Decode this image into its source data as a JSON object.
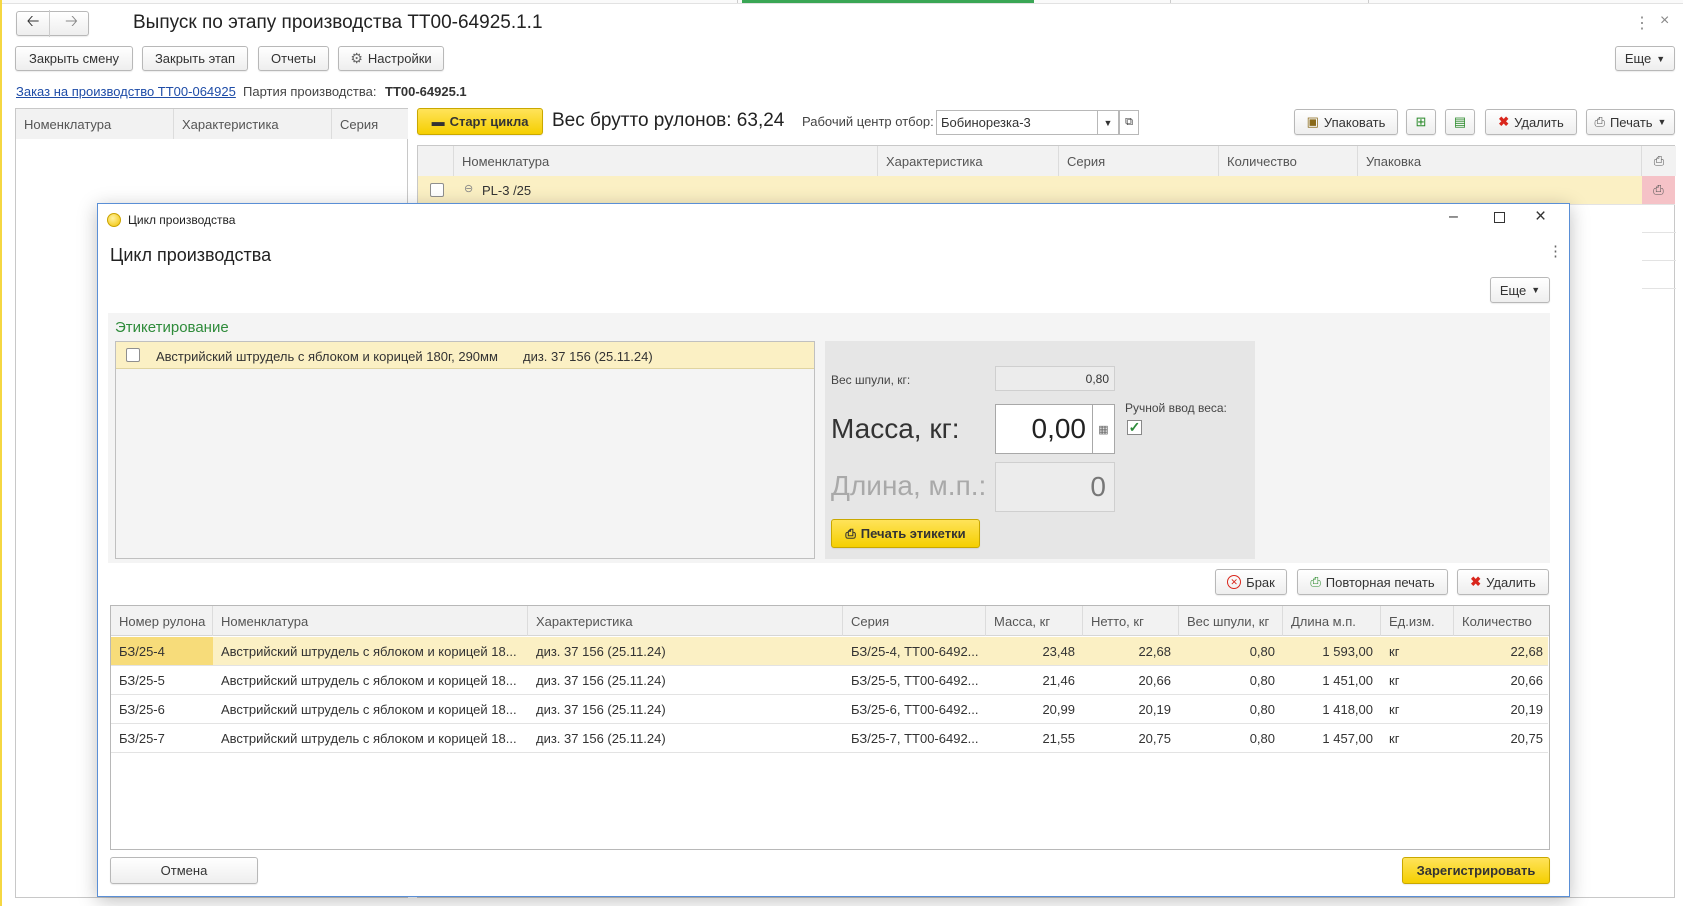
{
  "window": {
    "title": "Выпуск по этапу производства ТТ00-64925.1.1",
    "more_label": "Еще"
  },
  "toolbar": {
    "close_shift": "Закрыть смену",
    "close_stage": "Закрыть этап",
    "reports": "Отчеты",
    "settings": "Настройки"
  },
  "info": {
    "order_link": "Заказ на производство ТТ00-064925",
    "batch_label": "Партия производства:",
    "batch_value": "ТТ00-64925.1"
  },
  "left_table": {
    "columns": [
      "Номенклатура",
      "Характеристика",
      "Серия"
    ]
  },
  "cycle_bar": {
    "start_label": "Старт цикла",
    "gross_weight": "Вес брутто рулонов: 63,24",
    "workcenter_label": "Рабочий центр отбор:",
    "workcenter_value": "Бобинорезка-3",
    "pack_label": "Упаковать",
    "delete_label": "Удалить",
    "print_label": "Печать"
  },
  "right_table": {
    "columns": [
      "Номенклатура",
      "Характеристика",
      "Серия",
      "Количество",
      "Упаковка"
    ],
    "row_item": "PL-3 /25"
  },
  "dialog": {
    "window_title": "Цикл производства",
    "heading": "Цикл производства",
    "more_label": "Еще",
    "section_title": "Этикетирование",
    "label_item": {
      "name": "Австрийский штрудель с яблоком и корицей 180г, 290мм",
      "characteristic": "диз. 37 156 (25.11.24)"
    },
    "spool_weight_label": "Вес шпули, кг:",
    "spool_weight_value": "0,80",
    "mass_label": "Масса, кг:",
    "mass_value": "0,00",
    "manual_label": "Ручной ввод веса:",
    "manual_checked": true,
    "length_label": "Длина, м.п.:",
    "length_value": "0",
    "print_labels": "Печать этикетки",
    "defect_label": "Брак",
    "reprint_label": "Повторная печать",
    "delete_label": "Удалить",
    "columns": [
      "Номер рулона",
      "Номенклатура",
      "Характеристика",
      "Серия",
      "Масса, кг",
      "Нетто, кг",
      "Вес шпули, кг",
      "Длина м.п.",
      "Ед.изм.",
      "Количество"
    ],
    "rows": [
      [
        "БЗ/25-4",
        "Австрийский штрудель с яблоком и корицей 18...",
        "диз. 37 156 (25.11.24)",
        "БЗ/25-4, ТТ00-6492...",
        "23,48",
        "22,68",
        "0,80",
        "1 593,00",
        "кг",
        "22,68"
      ],
      [
        "БЗ/25-5",
        "Австрийский штрудель с яблоком и корицей 18...",
        "диз. 37 156 (25.11.24)",
        "БЗ/25-5, ТТ00-6492...",
        "21,46",
        "20,66",
        "0,80",
        "1 451,00",
        "кг",
        "20,66"
      ],
      [
        "БЗ/25-6",
        "Австрийский штрудель с яблоком и корицей 18...",
        "диз. 37 156 (25.11.24)",
        "БЗ/25-6, ТТ00-6492...",
        "20,99",
        "20,19",
        "0,80",
        "1 418,00",
        "кг",
        "20,19"
      ],
      [
        "БЗ/25-7",
        "Австрийский штрудель с яблоком и корицей 18...",
        "диз. 37 156 (25.11.24)",
        "БЗ/25-7, ТТ00-6492...",
        "21,55",
        "20,75",
        "0,80",
        "1 457,00",
        "кг",
        "20,75"
      ]
    ],
    "cancel_label": "Отмена",
    "register_label": "Зарегистрировать"
  },
  "colors": {
    "accent_yellow": "#f5cf00",
    "highlight_row": "#fbf0c4",
    "section_green": "#2e8b3a",
    "dialog_border": "#5a8fd6",
    "delete_red": "#d9261c"
  }
}
